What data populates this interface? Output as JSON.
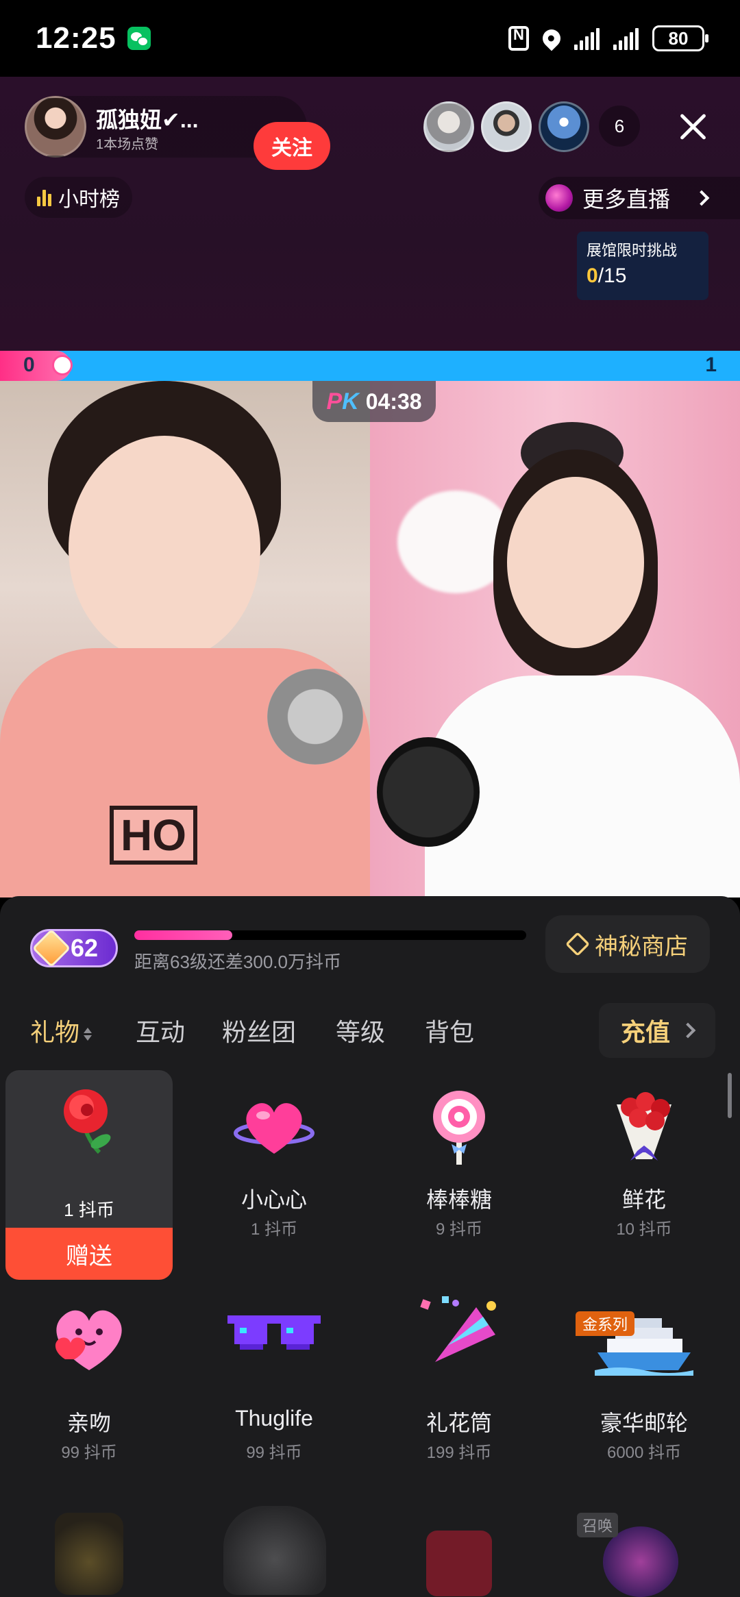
{
  "status_bar": {
    "time": "12:25",
    "battery": "80"
  },
  "header": {
    "host_name": "孤独妞✔...",
    "host_likes": "1本场点赞",
    "follow_label": "关注",
    "viewer_count": "6",
    "rank_label": "小时榜",
    "more_live_label": "更多直播",
    "challenge": {
      "title": "展馆限时挑战",
      "current": "0",
      "total": "/15"
    }
  },
  "pk": {
    "left_score": "0",
    "right_score": "1",
    "timer": "04:38",
    "logo_p": "P",
    "logo_k": "K"
  },
  "video": {
    "hoodie_print": "HO"
  },
  "gift_panel": {
    "level": "62",
    "level_progress": 0.25,
    "level_text": "距离63级还差300.0万抖币",
    "shop_label": "神秘商店",
    "tabs": [
      "礼物",
      "互动",
      "粉丝团",
      "等级",
      "背包"
    ],
    "recharge_label": "充值",
    "gifts": [
      {
        "name": "玫瑰",
        "price": "1 抖币",
        "icon": "rose-icon",
        "selected": true,
        "send_label": "赠送"
      },
      {
        "name": "小心心",
        "price": "1 抖币",
        "icon": "heart-icon"
      },
      {
        "name": "棒棒糖",
        "price": "9 抖币",
        "icon": "lollipop-icon"
      },
      {
        "name": "鲜花",
        "price": "10 抖币",
        "icon": "bouquet-icon"
      },
      {
        "name": "亲吻",
        "price": "99 抖币",
        "icon": "kiss-heart-icon"
      },
      {
        "name": "Thuglife",
        "price": "99 抖币",
        "icon": "pixel-sunglasses-icon"
      },
      {
        "name": "礼花筒",
        "price": "199 抖币",
        "icon": "party-popper-icon"
      },
      {
        "name": "豪华邮轮",
        "price": "6000 抖币",
        "icon": "cruise-ship-icon",
        "tag": "金系列"
      }
    ],
    "summon_tag": "召唤"
  },
  "colors": {
    "accent_gold": "#f5d07a",
    "follow_red": "#fe3b3b",
    "send_orange": "#fe4f36",
    "pk_pink": "#ff2f86",
    "pk_blue": "#1eb0ff"
  }
}
